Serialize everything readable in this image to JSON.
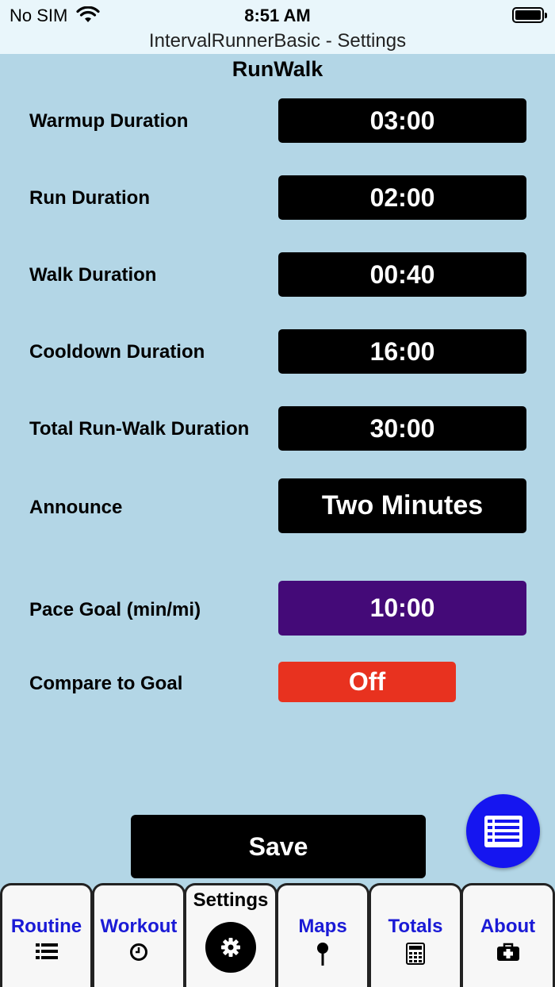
{
  "status_bar": {
    "carrier": "No SIM",
    "time": "8:51 AM"
  },
  "window": {
    "title": "IntervalRunnerBasic - Settings"
  },
  "section": {
    "title": "RunWalk"
  },
  "settings": {
    "warmup": {
      "label": "Warmup Duration",
      "value": "03:00"
    },
    "run": {
      "label": "Run Duration",
      "value": "02:00"
    },
    "walk": {
      "label": "Walk Duration",
      "value": "00:40"
    },
    "cooldown": {
      "label": "Cooldown Duration",
      "value": "16:00"
    },
    "total": {
      "label": "Total Run-Walk Duration",
      "value": "30:00"
    },
    "announce": {
      "label": "Announce",
      "value": "Two Minutes"
    },
    "pace_goal": {
      "label": "Pace Goal (min/mi)",
      "value": "10:00",
      "color": "#440a78"
    },
    "compare": {
      "label": "Compare to Goal",
      "value": "Off",
      "color": "#e8321f"
    }
  },
  "actions": {
    "save_label": "Save"
  },
  "fab": {
    "icon": "list-icon",
    "color": "#1515f0"
  },
  "tabs": [
    {
      "label": "Routine",
      "icon": "list-icon"
    },
    {
      "label": "Workout",
      "icon": "clock-icon"
    },
    {
      "label": "Settings",
      "icon": "gear-icon",
      "active": true
    },
    {
      "label": "Maps",
      "icon": "map-pin-icon"
    },
    {
      "label": "Totals",
      "icon": "calculator-icon"
    },
    {
      "label": "About",
      "icon": "first-aid-kit-icon"
    }
  ]
}
